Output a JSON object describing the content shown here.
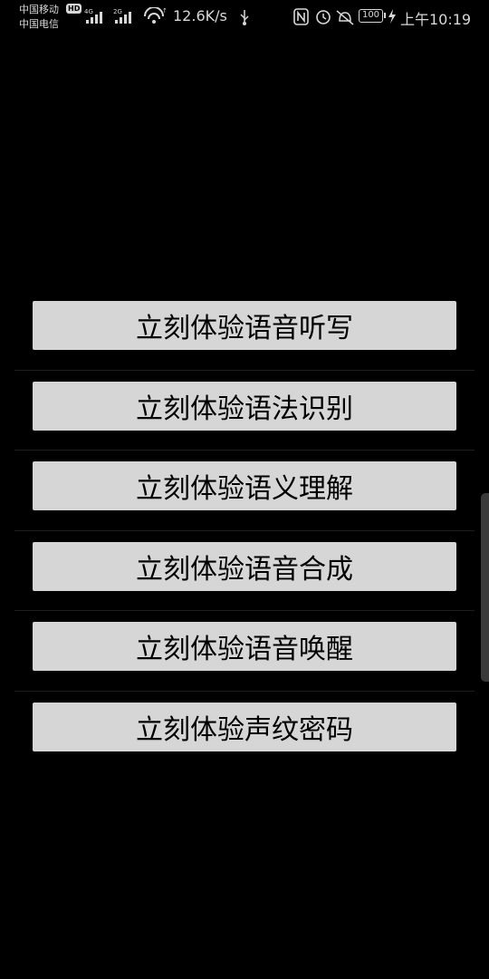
{
  "status_bar": {
    "carrier_1": "中国移动",
    "carrier_2": "中国电信",
    "hd_badge": "HD",
    "network_1": "4G",
    "network_2": "2G",
    "speed": "12.6K/s",
    "battery_level": "100",
    "time": "上午10:19",
    "icons": [
      "signal-icon",
      "signal-icon",
      "wifi-icon",
      "usb-icon",
      "nfc-icon",
      "alarm-icon",
      "mute-icon",
      "battery-icon",
      "charging-icon"
    ]
  },
  "features": [
    {
      "label": "立刻体验语音听写"
    },
    {
      "label": "立刻体验语法识别"
    },
    {
      "label": "立刻体验语义理解"
    },
    {
      "label": "立刻体验语音合成"
    },
    {
      "label": "立刻体验语音唤醒"
    },
    {
      "label": "立刻体验声纹密码"
    }
  ],
  "colors": {
    "background": "#000000",
    "button": "#d6d6d6",
    "button_text": "#000000",
    "divider": "#1e1e1e"
  }
}
